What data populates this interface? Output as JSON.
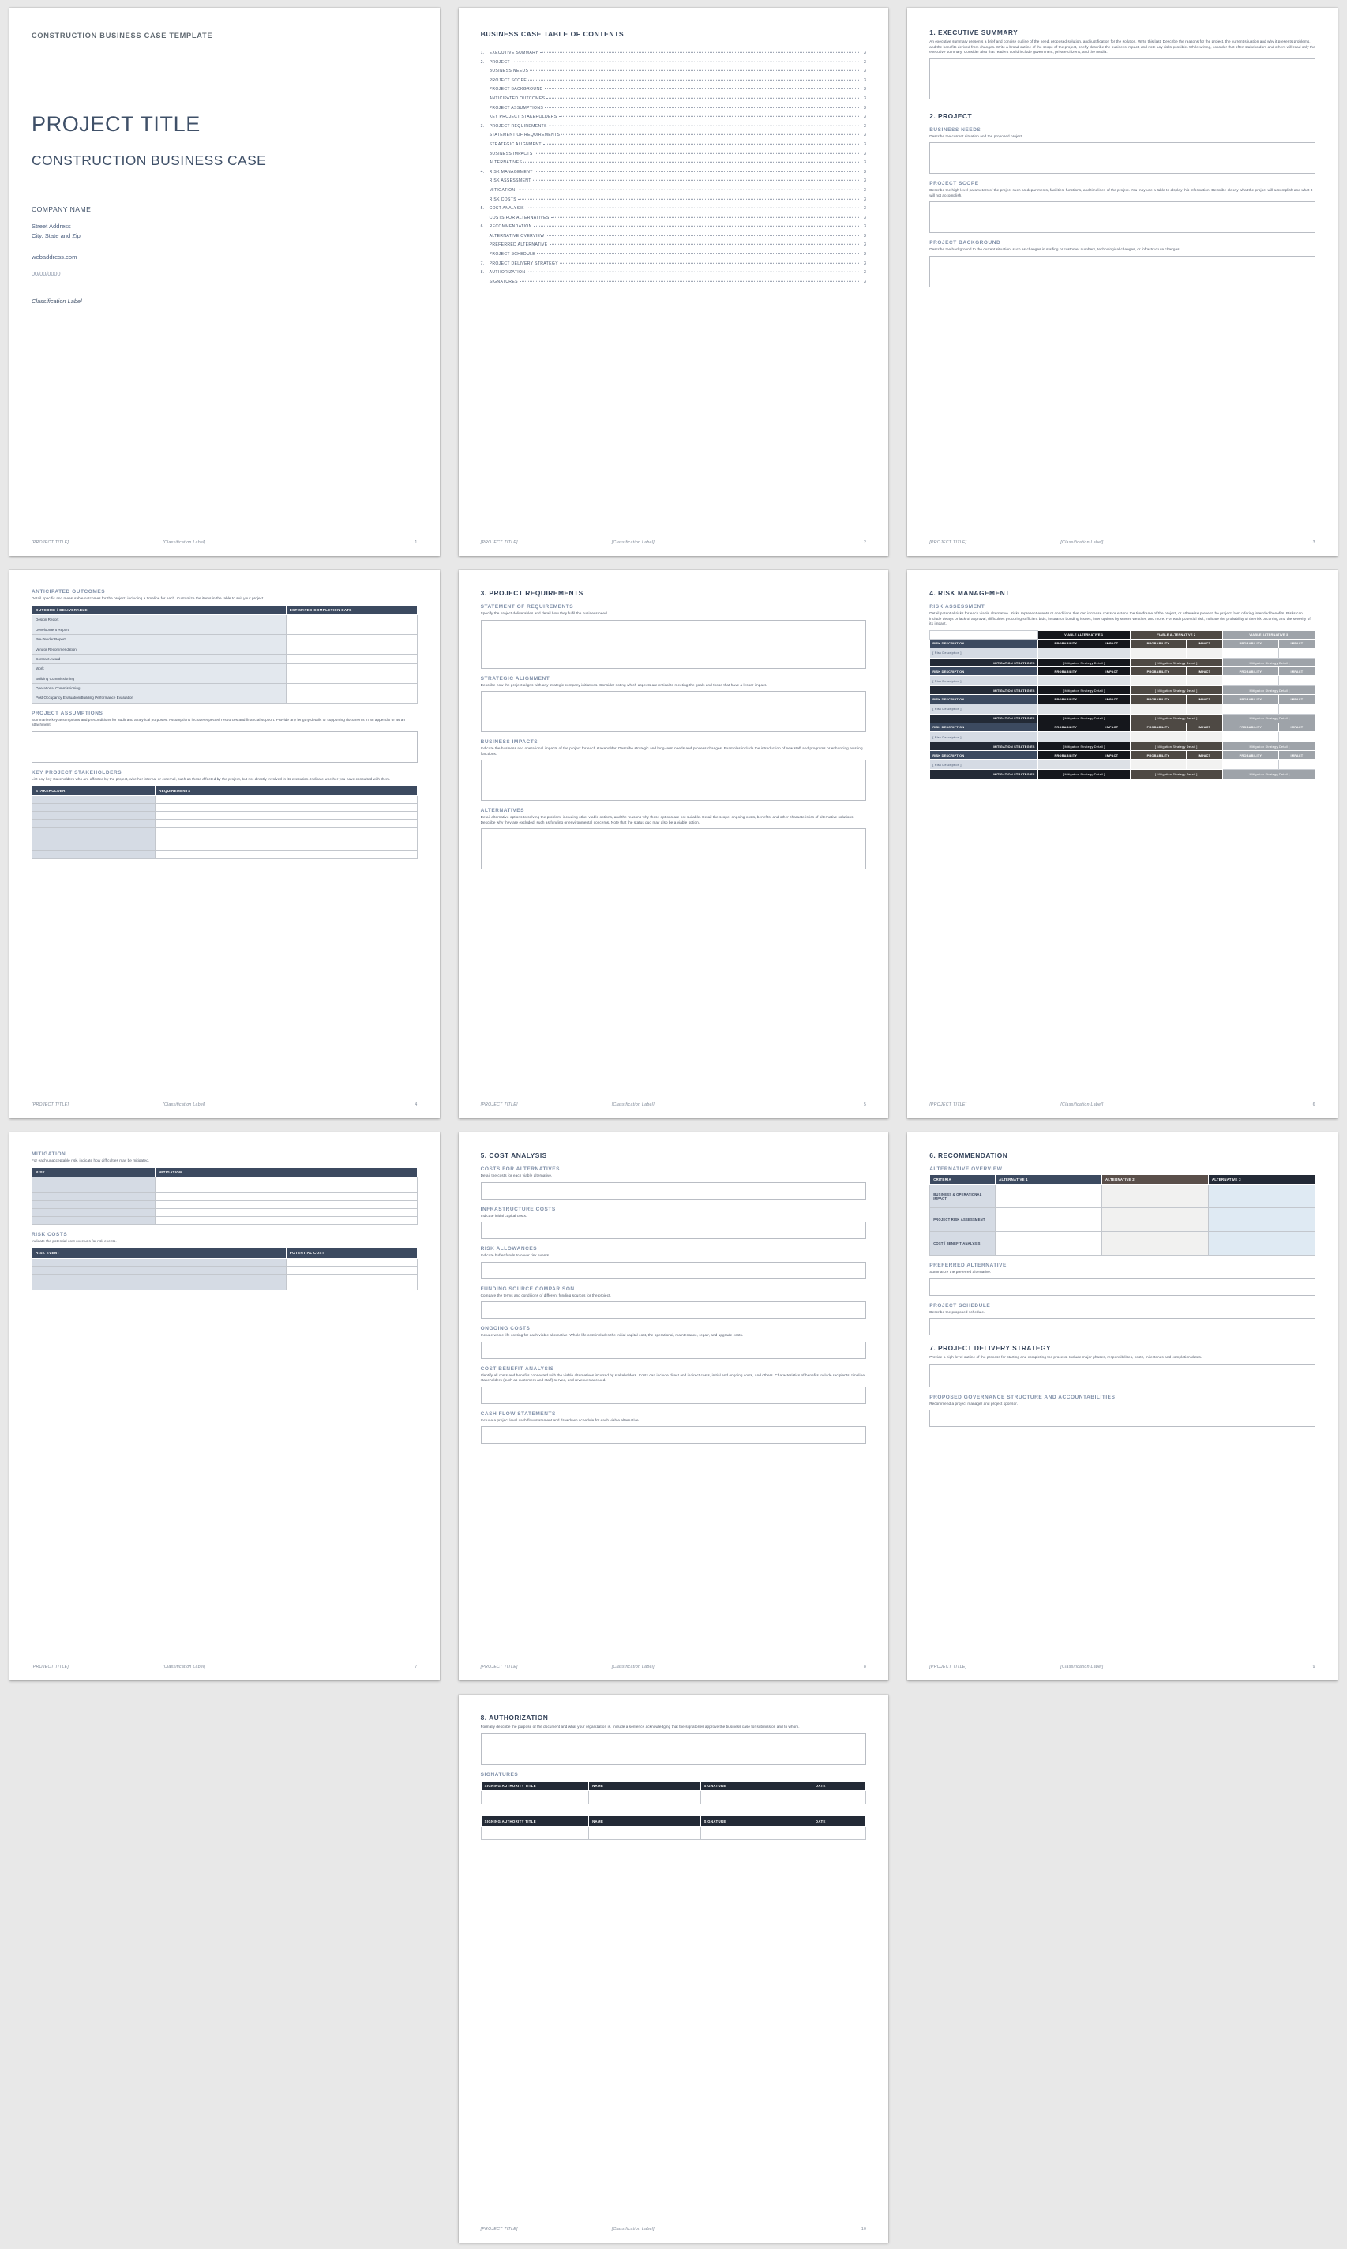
{
  "doc": {
    "eyebrow": "CONSTRUCTION BUSINESS CASE TEMPLATE",
    "footer_project": "[PROJECT TITLE]",
    "footer_class": "[Classification Label]"
  },
  "cover": {
    "title": "PROJECT TITLE",
    "subtitle": "CONSTRUCTION BUSINESS CASE",
    "company": "COMPANY NAME",
    "street": "Street Address",
    "city": "City, State and Zip",
    "web": "webaddress.com",
    "date": "00/00/0000",
    "classification": "Classification Label",
    "page_number": "1"
  },
  "toc": {
    "title": "BUSINESS CASE TABLE OF CONTENTS",
    "page_number": "2",
    "entries": [
      {
        "num": "1.",
        "label": "EXECUTIVE SUMMARY",
        "page": "3",
        "indent": false
      },
      {
        "num": "2.",
        "label": "PROJECT",
        "page": "3",
        "indent": false
      },
      {
        "num": "",
        "label": "BUSINESS NEEDS",
        "page": "3",
        "indent": true
      },
      {
        "num": "",
        "label": "PROJECT SCOPE",
        "page": "3",
        "indent": true
      },
      {
        "num": "",
        "label": "PROJECT BACKGROUND",
        "page": "3",
        "indent": true
      },
      {
        "num": "",
        "label": "ANTICIPATED OUTCOMES",
        "page": "3",
        "indent": true
      },
      {
        "num": "",
        "label": "PROJECT ASSUMPTIONS",
        "page": "3",
        "indent": true
      },
      {
        "num": "",
        "label": "KEY PROJECT STAKEHOLDERS",
        "page": "3",
        "indent": true
      },
      {
        "num": "3.",
        "label": "PROJECT REQUIREMENTS",
        "page": "3",
        "indent": false
      },
      {
        "num": "",
        "label": "STATEMENT OF REQUIREMENTS",
        "page": "3",
        "indent": true
      },
      {
        "num": "",
        "label": "STRATEGIC ALIGNMENT",
        "page": "3",
        "indent": true
      },
      {
        "num": "",
        "label": "BUSINESS IMPACTS",
        "page": "3",
        "indent": true
      },
      {
        "num": "",
        "label": "ALTERNATIVES",
        "page": "3",
        "indent": true
      },
      {
        "num": "4.",
        "label": "RISK MANAGEMENT",
        "page": "3",
        "indent": false
      },
      {
        "num": "",
        "label": "RISK ASSESSMENT",
        "page": "3",
        "indent": true
      },
      {
        "num": "",
        "label": "MITIGATION",
        "page": "3",
        "indent": true
      },
      {
        "num": "",
        "label": "RISK COSTS",
        "page": "3",
        "indent": true
      },
      {
        "num": "5.",
        "label": "COST ANALYSIS",
        "page": "3",
        "indent": false
      },
      {
        "num": "",
        "label": "COSTS FOR ALTERNATIVES",
        "page": "3",
        "indent": true
      },
      {
        "num": "6.",
        "label": "RECOMMENDATION",
        "page": "3",
        "indent": false
      },
      {
        "num": "",
        "label": "ALTERNATIVE OVERVIEW",
        "page": "3",
        "indent": true
      },
      {
        "num": "",
        "label": "PREFERRED ALTERNATIVE",
        "page": "3",
        "indent": true
      },
      {
        "num": "",
        "label": "PROJECT SCHEDULE",
        "page": "3",
        "indent": true
      },
      {
        "num": "7.",
        "label": "PROJECT DELIVERY STRATEGY",
        "page": "3",
        "indent": false
      },
      {
        "num": "8.",
        "label": "AUTHORIZATION",
        "page": "3",
        "indent": false
      },
      {
        "num": "",
        "label": "SIGNATURES",
        "page": "3",
        "indent": true
      }
    ]
  },
  "page3": {
    "page_number": "3",
    "exec_heading": "1.  EXECUTIVE SUMMARY",
    "exec_desc": "An executive summary presents a brief and concise outline of the need, proposed solution, and justification for the solution. Write this last. Describe the reasons for the project, the current situation and why it presents problems, and the benefits derived from changes. Write a broad outline of the scope of the project, briefly describe the business impact, and note any risks possible. While writing, consider that often stakeholders and others will read only the executive summary. Consider also that readers could include government, private citizens, and the media.",
    "project_heading": "2.  PROJECT",
    "business_needs_heading": "BUSINESS NEEDS",
    "business_needs_desc": "Describe the current situation and the proposed project.",
    "project_scope_heading": "PROJECT SCOPE",
    "project_scope_desc": "Describe the high-level parameters of the project such as departments, facilities, functions, and timelines of the project. You may use a table to display this information. Describe clearly what the project will accomplish and what it will not accomplish.",
    "project_background_heading": "PROJECT BACKGROUND",
    "project_background_desc": "Describe the background to the current situation, such as changes in staffing or customer numbers, technological changes, or infrastructure changes."
  },
  "page4": {
    "page_number": "4",
    "outcomes_heading": "ANTICIPATED OUTCOMES",
    "outcomes_desc": "Detail specific and measurable outcomes for the project, including a timeline for each. Customize the items in the table to suit your project.",
    "outcomes_table": {
      "headers": [
        "OUTCOME / DELIVERABLE",
        "ESTIMATED COMPLETION DATE"
      ],
      "rows": [
        "Design Report",
        "Development Report",
        "Pre-Tender Report",
        "Vendor Recommendation",
        "Contract Award",
        "Work",
        "Building Commissioning",
        "Operational Commissioning",
        "Post Occupancy Evaluation/Building Performance Evaluation"
      ]
    },
    "assumptions_heading": "PROJECT ASSUMPTIONS",
    "assumptions_desc": "Summarize key assumptions and preconditions for audit and analytical purposes. Assumptions include expected resources and financial support. Provide any lengthy details or supporting documents in an appendix or as an attachment.",
    "stakeholders_heading": "KEY PROJECT STAKEHOLDERS",
    "stakeholders_desc": "List any key stakeholders who are affected by the project, whether internal or external, such as those affected by the project, but not directly involved in its execution. Indicate whether you have consulted with them.",
    "stakeholders_table": {
      "headers": [
        "STAKEHOLDER",
        "REQUIREMENTS"
      ],
      "row_count": 8
    }
  },
  "page5": {
    "page_number": "5",
    "heading": "3.  PROJECT REQUIREMENTS",
    "sor_heading": "STATEMENT OF REQUIREMENTS",
    "sor_desc": "Specify the project deliverables and detail how they fulfil the business need.",
    "sa_heading": "STRATEGIC ALIGNMENT",
    "sa_desc": "Describe how the project aligns with any strategic company initiatives. Consider noting which aspects are critical to meeting the goals and those that have a lesser impact.",
    "bi_heading": "BUSINESS IMPACTS",
    "bi_desc": "Indicate the business and operational impacts of the project for each stakeholder. Describe strategic and long-term needs and process changes. Examples include the introduction of new staff and programs or enhancing existing functions.",
    "alt_heading": "ALTERNATIVES",
    "alt_desc": "Detail alternative options to solving the problem, including other viable options, and the reasons why these options are not suitable. Detail the scope, ongoing costs, benefits, and other characteristics of alternative solutions. Describe why they are excluded, such as funding or environmental concerns. Note that the status quo may also be a viable option."
  },
  "page6": {
    "page_number": "6",
    "heading": "4.  RISK MANAGEMENT",
    "ra_heading": "RISK ASSESSMENT",
    "ra_desc": "Detail potential risks for each viable alternative. Risks represent events or conditions that can increase costs or extend the timeframe of the project, or otherwise prevent the project from offering intended benefits. Risks can include delays or lack of approval, difficulties procuring sufficient bids, insurance bonding issues, interruptions by severe weather, and more. For each potential risk, indicate the probability of the risk occurring and the severity of its impact.",
    "alt_headers": [
      "VIABLE ALTERNATIVE 1",
      "VIABLE ALTERNATIVE 2",
      "VIABLE ALTERNATIVE 3"
    ],
    "risk_desc_header": "RISK DESCRIPTION",
    "probability_header": "PROBABILITY",
    "impact_header": "IMPACT",
    "risk_placeholder": "[ Risk Description ]",
    "mitigation_header": "MITIGATION STRATEGIES",
    "mitigation_placeholder": "[ Mitigation Strategy Detail ]",
    "risk_block_count": 5
  },
  "page7": {
    "page_number": "7",
    "mitigation_heading": "MITIGATION",
    "mitigation_desc": "For each unacceptable risk, indicate how difficulties may be mitigated.",
    "mitigation_table": {
      "headers": [
        "RISK",
        "MITIGATION"
      ],
      "row_count": 6
    },
    "riskcosts_heading": "RISK COSTS",
    "riskcosts_desc": "Indicate the potential cost overruns for risk events.",
    "riskcosts_table": {
      "headers": [
        "RISK EVENT",
        "POTENTIAL COST"
      ],
      "row_count": 4
    }
  },
  "page8": {
    "page_number": "8",
    "heading": "5.  COST ANALYSIS",
    "sections": [
      {
        "heading": "COSTS FOR ALTERNATIVES",
        "desc": "Detail the costs for each viable alternative."
      },
      {
        "heading": "INFRASTRUCTURE COSTS",
        "desc": "Indicate initial capital costs."
      },
      {
        "heading": "RISK ALLOWANCES",
        "desc": "Indicate buffer funds to cover risk events."
      },
      {
        "heading": "FUNDING SOURCE COMPARISON",
        "desc": "Compare the terms and conditions of different funding sources for the project."
      },
      {
        "heading": "ONGOING COSTS",
        "desc": "Include whole life costing for each viable alternative. Whole life cost includes the initial capital cost, the operational, maintenance, repair, and upgrade costs."
      },
      {
        "heading": "COST BENEFIT ANALYSIS",
        "desc": "Identify all costs and benefits connected with the viable alternatives incurred by stakeholders. Costs can include direct and indirect costs, initial and ongoing costs, and others. Characteristics of benefits include recipients, timeline, stakeholders (such as customers and staff) served, and revenues accrued."
      },
      {
        "heading": "CASH FLOW STATEMENTS",
        "desc": "Include a project level cash flow statement and drawdown schedule for each viable alternative."
      }
    ]
  },
  "page9": {
    "page_number": "9",
    "heading": "6.  RECOMMENDATION",
    "ao_heading": "ALTERNATIVE OVERVIEW",
    "ao_table": {
      "headers": [
        "CRITERIA",
        "ALTERNATIVE 1",
        "ALTERNATIVE 2",
        "ALTERNATIVE 3"
      ],
      "criteria": [
        "BUSINESS & OPERATIONAL IMPACT",
        "PROJECT RISK ASSESSMENT",
        "COST / BENEFIT ANALYSIS"
      ]
    },
    "pa_heading": "PREFERRED ALTERNATIVE",
    "pa_desc": "Summarize the preferred alternative.",
    "ps_heading": "PROJECT SCHEDULE",
    "ps_desc": "Describe the proposed schedule.",
    "pds_heading": "7.  PROJECT DELIVERY STRATEGY",
    "pds_desc": "Provide a high-level outline of the process for starting and completing the process. Include major phases, responsibilities, costs, milestones and completion dates.",
    "gov_heading": "PROPOSED GOVERNANCE STRUCTURE AND ACCOUNTABILITIES",
    "gov_desc": "Recommend a project manager and project sponsor."
  },
  "page10": {
    "page_number": "10",
    "heading": "8.  AUTHORIZATION",
    "desc": "Formally describe the purpose of the document and what your organization is. Include a sentence acknowledging that the signatories approve the business case for submission and to whom.",
    "sig_heading": "SIGNATURES",
    "sig_headers": [
      "SIGNING AUTHORITY TITLE",
      "NAME",
      "SIGNATURE",
      "DATE"
    ],
    "sig_table_count": 2
  }
}
